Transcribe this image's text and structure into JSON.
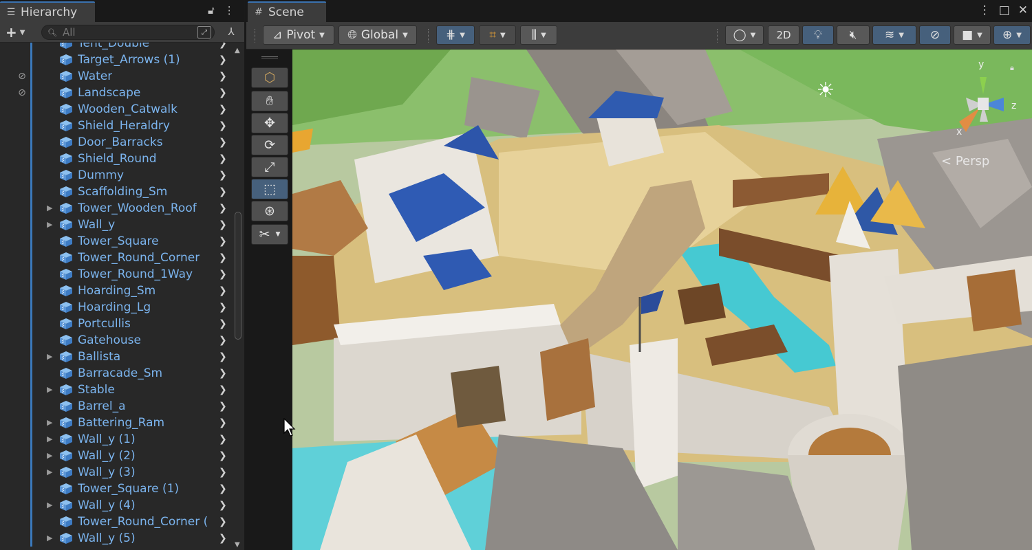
{
  "hierarchy": {
    "tab_label": "Hierarchy",
    "tab_icon": "list-icon",
    "search_placeholder": "All",
    "rows": [
      {
        "label": "Tent_Double",
        "expandable": false,
        "hidden_icon": false
      },
      {
        "label": "Target_Arrows  (1)",
        "expandable": false,
        "hidden_icon": false
      },
      {
        "label": "Water",
        "expandable": false,
        "hidden_icon": true
      },
      {
        "label": "Landscape",
        "expandable": false,
        "hidden_icon": true
      },
      {
        "label": "Wooden_Catwalk",
        "expandable": false,
        "hidden_icon": false
      },
      {
        "label": "Shield_Heraldry",
        "expandable": false,
        "hidden_icon": false
      },
      {
        "label": "Door_Barracks",
        "expandable": false,
        "hidden_icon": false
      },
      {
        "label": "Shield_Round",
        "expandable": false,
        "hidden_icon": false
      },
      {
        "label": "Dummy",
        "expandable": false,
        "hidden_icon": false
      },
      {
        "label": "Scaffolding_Sm",
        "expandable": false,
        "hidden_icon": false
      },
      {
        "label": "Tower_Wooden_Roof",
        "expandable": true,
        "hidden_icon": false
      },
      {
        "label": "Wall_y",
        "expandable": true,
        "hidden_icon": false
      },
      {
        "label": "Tower_Square",
        "expandable": false,
        "hidden_icon": false
      },
      {
        "label": "Tower_Round_Corner",
        "expandable": false,
        "hidden_icon": false
      },
      {
        "label": "Tower_Round_1Way",
        "expandable": false,
        "hidden_icon": false
      },
      {
        "label": "Hoarding_Sm",
        "expandable": false,
        "hidden_icon": false
      },
      {
        "label": "Hoarding_Lg",
        "expandable": false,
        "hidden_icon": false
      },
      {
        "label": "Portcullis",
        "expandable": false,
        "hidden_icon": false
      },
      {
        "label": "Gatehouse",
        "expandable": false,
        "hidden_icon": false
      },
      {
        "label": "Ballista",
        "expandable": true,
        "hidden_icon": false
      },
      {
        "label": "Barracade_Sm",
        "expandable": false,
        "hidden_icon": false
      },
      {
        "label": "Stable",
        "expandable": true,
        "hidden_icon": false
      },
      {
        "label": "Barrel_a",
        "expandable": false,
        "hidden_icon": false
      },
      {
        "label": "Battering_Ram",
        "expandable": true,
        "hidden_icon": false
      },
      {
        "label": "Wall_y (1)",
        "expandable": true,
        "hidden_icon": false
      },
      {
        "label": "Wall_y (2)",
        "expandable": true,
        "hidden_icon": false
      },
      {
        "label": "Wall_y (3)",
        "expandable": true,
        "hidden_icon": false
      },
      {
        "label": "Tower_Square (1)",
        "expandable": false,
        "hidden_icon": false
      },
      {
        "label": "Wall_y (4)",
        "expandable": true,
        "hidden_icon": false
      },
      {
        "label": "Tower_Round_Corner (",
        "expandable": false,
        "hidden_icon": false
      },
      {
        "label": "Wall_y (5)",
        "expandable": true,
        "hidden_icon": false
      }
    ]
  },
  "scene": {
    "tab_label": "Scene",
    "tab_icon": "grid-hash-icon",
    "toolbar": {
      "pivot_label": "Pivot",
      "global_label": "Global",
      "mode_2d_label": "2D"
    },
    "gizmo": {
      "axis_y": "y",
      "axis_x": "x",
      "axis_z": "z",
      "projection_label": "Persp"
    },
    "colors": {
      "label_blue": "#7bb4ee",
      "selection_bar": "#3a79bb",
      "active_button": "#46607c",
      "panel_bg": "#282828"
    }
  }
}
